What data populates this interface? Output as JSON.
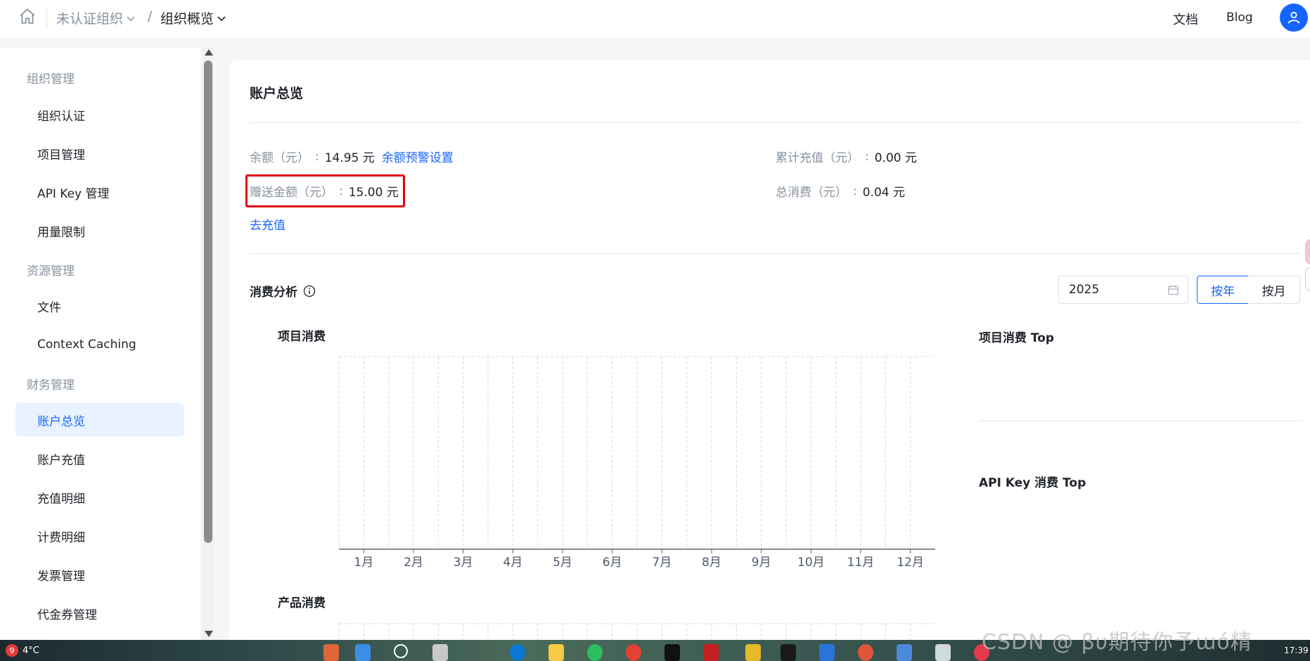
{
  "header": {
    "org_name": "未认证组织",
    "separator": "/",
    "current": "组织概览",
    "docs": "文档",
    "blog": "Blog"
  },
  "sidebar": {
    "groups": [
      "组织管理",
      "资源管理",
      "财务管理"
    ],
    "items": [
      {
        "label": "组织认证"
      },
      {
        "label": "项目管理"
      },
      {
        "label": "API Key 管理"
      },
      {
        "label": "用量限制"
      },
      {
        "label": "文件"
      },
      {
        "label": "Context Caching"
      },
      {
        "label": "账户总览"
      },
      {
        "label": "账户充值"
      },
      {
        "label": "充值明细"
      },
      {
        "label": "计费明细"
      },
      {
        "label": "发票管理"
      },
      {
        "label": "代金券管理"
      }
    ]
  },
  "overview": {
    "title": "账户总览",
    "balance_label": "余额（元）",
    "balance_value": "14.95 元",
    "balance_alert_link": "余额预警设置",
    "gift_label": "赠送金额（元）",
    "gift_value": "15.00 元",
    "total_recharge_label": "累计充值（元）",
    "total_recharge_value": "0.00 元",
    "total_spend_label": "总消费（元）",
    "total_spend_value": "0.04 元",
    "recharge_link": "去充值",
    "colon": ":"
  },
  "analysis": {
    "title": "消费分析",
    "year_value": "2025",
    "btn_year": "按年",
    "btn_month": "按月",
    "project_spend_title": "项目消费",
    "project_top_title": "项目消费 Top",
    "apikey_top_title": "API Key 消费 Top",
    "product_spend_title": "产品消费"
  },
  "chart_data": {
    "type": "bar",
    "title": "项目消费",
    "categories": [
      "1月",
      "2月",
      "3月",
      "4月",
      "5月",
      "6月",
      "7月",
      "8月",
      "9月",
      "10月",
      "11月",
      "12月"
    ],
    "values": [],
    "grid": true
  },
  "taskbar": {
    "weather_badge": "9",
    "temperature": "4°C",
    "time": "17:39"
  },
  "watermark": "CSDN @ βυ期待你予ɯó精",
  "colors": {
    "accent": "#1664ff",
    "highlight_box": "#e3000f",
    "active_bg": "#e8f3ff"
  }
}
